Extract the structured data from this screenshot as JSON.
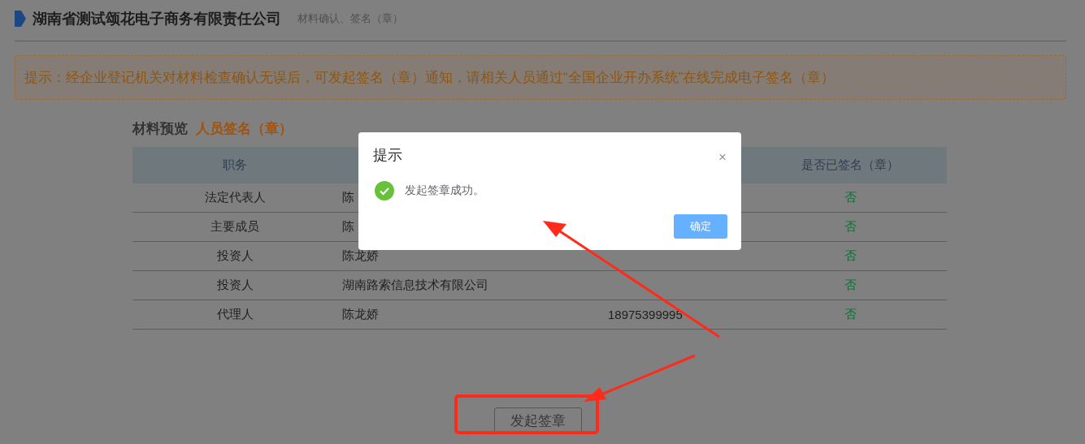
{
  "header": {
    "company": "湖南省测试颂花电子商务有限责任公司",
    "subtitle": "材料确认、签名（章）"
  },
  "notice": "提示：经企业登记机关对材料检查确认无误后，可发起签名（章）通知，请相关人员通过“全国企业开办系统”在线完成电子签名（章）",
  "section": {
    "label": "材料预览",
    "title": "人员签名（章）"
  },
  "table": {
    "columns": [
      "职务",
      "",
      "",
      "是否已签名（章）"
    ],
    "rows": [
      [
        "法定代表人",
        "陈",
        "",
        "否"
      ],
      [
        "主要成员",
        "陈",
        "",
        "否"
      ],
      [
        "投资人",
        "陈龙娇",
        "",
        "否"
      ],
      [
        "投资人",
        "湖南路索信息技术有限公司",
        "",
        "否"
      ],
      [
        "代理人",
        "陈龙娇",
        "18975399995",
        "否"
      ]
    ]
  },
  "action_button": "发起签章",
  "dialog": {
    "title": "提示",
    "close": "×",
    "message": "发起签章成功。",
    "confirm": "确定"
  }
}
